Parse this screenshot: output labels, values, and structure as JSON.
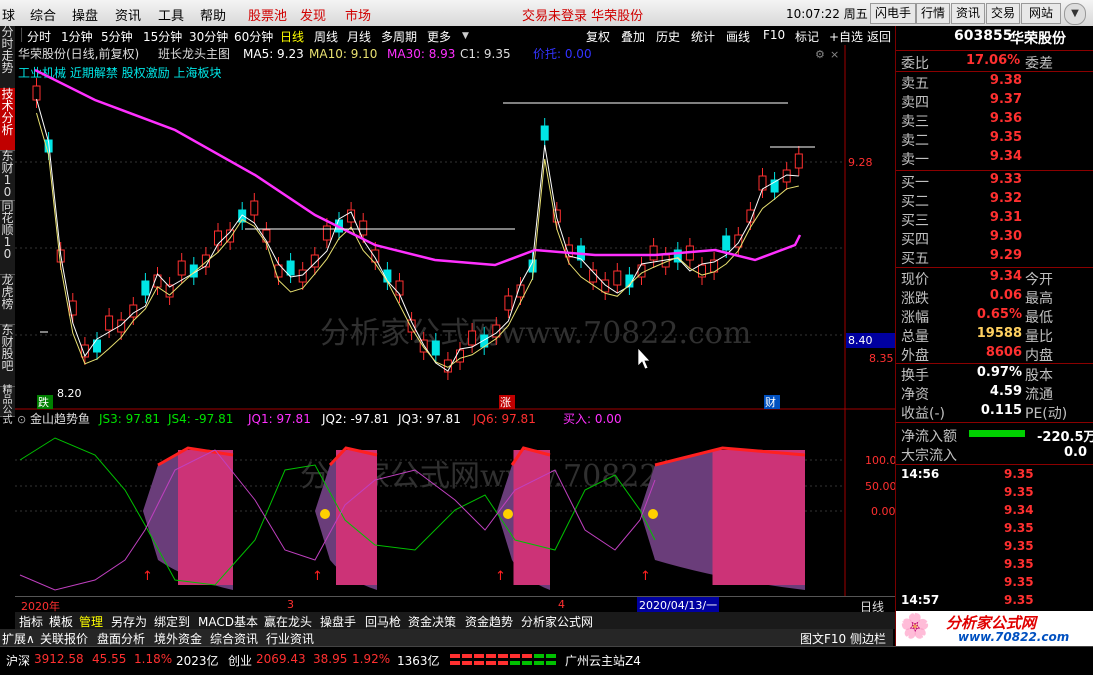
{
  "menu": {
    "items": [
      "球",
      "综合",
      "操盘",
      "资讯",
      "工具",
      "帮助"
    ],
    "red_items": [
      "股票池",
      "发现",
      "市场"
    ],
    "login_text": "交易未登录 华荣股份",
    "clock": "10:07:22 周五",
    "right_buttons": [
      "闪电手",
      "行情",
      "资讯",
      "交易",
      "网站"
    ]
  },
  "left_tabs": [
    "分时走势",
    "技术分析",
    "东财10",
    "同花顺10",
    "龙虎榜",
    "东财股吧",
    "精品公式"
  ],
  "periods": [
    "分时",
    "1分钟",
    "5分钟",
    "15分钟",
    "30分钟",
    "60分钟",
    "日线",
    "周线",
    "月线",
    "多周期",
    "更多"
  ],
  "active_period": "日线",
  "toolbar_right": [
    "复权",
    "叠加",
    "历史",
    "统计",
    "画线",
    "F10",
    "标记",
    "+自选",
    "返回"
  ],
  "chart_header": {
    "title": "华荣股份(日线,前复权)",
    "formula": "班长龙头主图",
    "ma5": "MA5: 9.23",
    "ma10": "MA10: 9.10",
    "ma30": "MA30: 8.93",
    "c1": "C1: 9.35",
    "support": "价托: 0.00",
    "concepts": "工业机械 近期解禁 股权激励 上海板块"
  },
  "price_axis": {
    "labels": [
      "9.28",
      "8.40",
      "8.35"
    ],
    "current": "8.40"
  },
  "price_chart_labels": {
    "low": "8.20",
    "mark_left": "跌",
    "mark_mid": "涨",
    "mark_right": "财"
  },
  "watermark": "分析家公式网www.70822.com",
  "indicator_header": {
    "name": "金山趋势鱼",
    "js3": "JS3: 97.81",
    "js4": "JS4: -97.81",
    "jq1": "JQ1: 97.81",
    "jq2": "JQ2: -97.81",
    "jq3": "JQ3: 97.81",
    "jq6": "JQ6: 97.81",
    "buy": "买入: 0.00"
  },
  "indicator_axis": [
    "100.0",
    "50.00",
    "0.00"
  ],
  "date_bar": {
    "year": "2020年",
    "m3": "3",
    "m4": "4",
    "cursor": "2020/04/13/一",
    "period": "日线"
  },
  "tabs": [
    "指标",
    "模板",
    "管理",
    "另存为",
    "绑定到",
    "MACD基本",
    "赢在龙头",
    "操盘手",
    "回马枪",
    "资金决策",
    "资金趋势",
    "分析家公式网"
  ],
  "footer_tabs": [
    "扩展∧",
    "关联报价",
    "盘面分析",
    "境外资金",
    "综合资讯",
    "行业资讯"
  ],
  "footer_right": [
    "图文F10",
    "侧边栏"
  ],
  "status": {
    "sh_label": "沪深",
    "sh_val": "3912.58",
    "sh_chg": "45.55",
    "sh_pct": "1.18%",
    "sh_amt": "2023亿",
    "cy_label": "创业",
    "cy_val": "2069.43",
    "cy_chg": "38.95",
    "cy_pct": "1.92%",
    "cy_amt": "1363亿",
    "server": "广州云主站Z4"
  },
  "stock": {
    "code": "603855",
    "name": "华荣股份"
  },
  "weibi": {
    "label": "委比",
    "value": "17.06%",
    "label2": "委差"
  },
  "asks": [
    {
      "label": "卖五",
      "price": "9.38"
    },
    {
      "label": "卖四",
      "price": "9.37"
    },
    {
      "label": "卖三",
      "price": "9.36"
    },
    {
      "label": "卖二",
      "price": "9.35"
    },
    {
      "label": "卖一",
      "price": "9.34"
    }
  ],
  "bids": [
    {
      "label": "买一",
      "price": "9.33"
    },
    {
      "label": "买二",
      "price": "9.32"
    },
    {
      "label": "买三",
      "price": "9.31"
    },
    {
      "label": "买四",
      "price": "9.30"
    },
    {
      "label": "买五",
      "price": "9.29"
    }
  ],
  "quote": [
    {
      "label": "现价",
      "value": "9.34",
      "label2": "今开",
      "color": "#ff3030"
    },
    {
      "label": "涨跌",
      "value": "0.06",
      "label2": "最高",
      "color": "#ff3030"
    },
    {
      "label": "涨幅",
      "value": "0.65%",
      "label2": "最低",
      "color": "#ff3030"
    },
    {
      "label": "总量",
      "value": "19588",
      "label2": "量比",
      "color": "#ffd060"
    },
    {
      "label": "外盘",
      "value": "8606",
      "label2": "内盘",
      "color": "#ff3030"
    }
  ],
  "fundamentals": [
    {
      "label": "换手",
      "value": "0.97%",
      "label2": "股本"
    },
    {
      "label": "净资",
      "value": "4.59",
      "label2": "流通"
    },
    {
      "label": "收益(-)",
      "value": "0.115",
      "label2": "PE(动)"
    }
  ],
  "flow": [
    {
      "label": "净流入额",
      "value": "-220.5万"
    },
    {
      "label": "大宗流入",
      "value": "0.0"
    }
  ],
  "ticks": [
    {
      "time": "14:56",
      "price": "9.35"
    },
    {
      "time": "",
      "price": "9.35"
    },
    {
      "time": "",
      "price": "9.34"
    },
    {
      "time": "",
      "price": "9.35"
    },
    {
      "time": "",
      "price": "9.35"
    },
    {
      "time": "",
      "price": "9.35"
    },
    {
      "time": "",
      "price": "9.35"
    },
    {
      "time": "14:57",
      "price": "9.35"
    }
  ],
  "logo": {
    "text": "分析家公式网",
    "url": "www.70822.com"
  },
  "colors": {
    "up": "#ff3030",
    "down": "#00e5e5",
    "ma5": "#ffffff",
    "ma10": "#e8e070",
    "ma30": "#ff30ff",
    "accent": "#c00000"
  }
}
